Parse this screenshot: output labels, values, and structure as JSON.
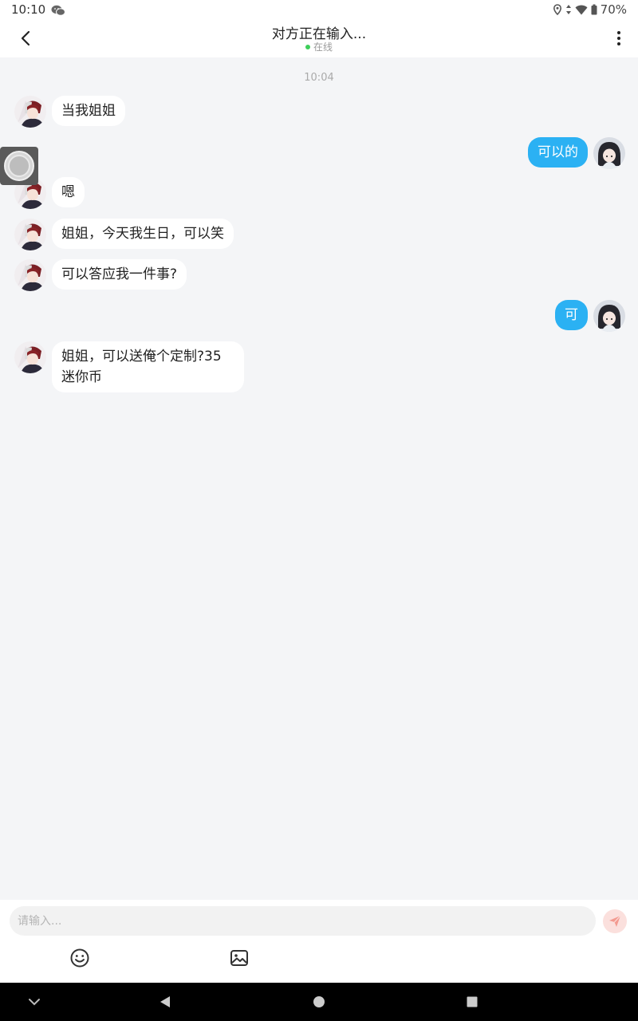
{
  "status_bar": {
    "time": "10:10",
    "battery": "70%",
    "icons": [
      "wechat-icon",
      "location-icon",
      "data-arrows-icon",
      "wifi-icon",
      "battery-icon"
    ]
  },
  "header": {
    "title": "对方正在输入...",
    "status": "在线",
    "status_color": "#3ecf5a"
  },
  "chat": {
    "timestamp": "10:04",
    "messages": [
      {
        "side": "left",
        "text": "当我姐姐"
      },
      {
        "side": "right",
        "text": "可以的"
      },
      {
        "side": "left",
        "text": "嗯"
      },
      {
        "side": "left",
        "text": "姐姐，今天我生日，可以笑"
      },
      {
        "side": "left",
        "text": "可以答应我一件事?"
      },
      {
        "side": "right",
        "text": "可"
      },
      {
        "side": "left",
        "text": "姐姐，可以送俺个定制?35迷你币"
      }
    ]
  },
  "composer": {
    "placeholder": "请输入...",
    "tools": [
      "emoji-icon",
      "image-icon"
    ]
  },
  "colors": {
    "accent_bubble": "#2bb1f3",
    "background": "#f4f5f7",
    "send_button": "#f5a49c"
  }
}
